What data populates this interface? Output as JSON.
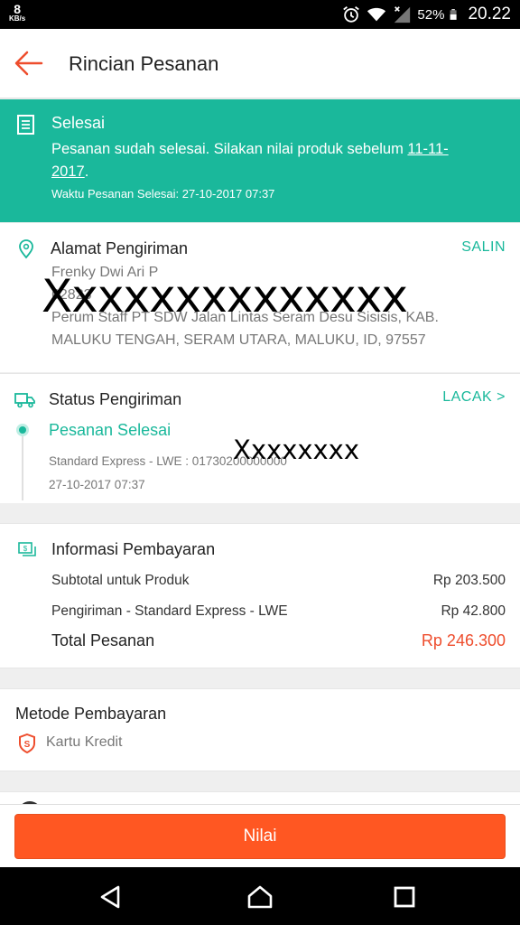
{
  "status_bar": {
    "net_speed_value": "8",
    "net_speed_unit": "KB/s",
    "battery_percent": "52%",
    "time": "20.22",
    "icons": [
      "alarm-icon",
      "wifi-icon",
      "signal-icon",
      "battery-icon"
    ]
  },
  "app_bar": {
    "title": "Rincian Pesanan",
    "accent_color": "#ee4d2d"
  },
  "banner": {
    "title": "Selesai",
    "message_prefix": "Pesanan sudah selesai. Silakan nilai produk sebelum ",
    "message_date": "11-11-2017",
    "message_suffix": ".",
    "completed_time": "Waktu Pesanan Selesai: 27-10-2017 07:37",
    "color": "#1ab89b"
  },
  "address": {
    "title": "Alamat Pengiriman",
    "action": "SALIN",
    "name": "Frenky Dwi Ari P",
    "phone": "62823",
    "line1": "Perum Staff PT SDW Jalan Lintas Seram Desu Sisisis, KAB.",
    "line2": "MALUKU TENGAH, SERAM UTARA, MALUKU, ID, 97557",
    "redaction": "Xxxxxxxxxxxxxx"
  },
  "shipping": {
    "title": "Status Pengiriman",
    "action": "LACAK >",
    "status": "Pesanan Selesai",
    "service": "Standard Express - LWE :  01730200000000",
    "timestamp": "27-10-2017 07:37",
    "redaction": "Xxxxxxxx"
  },
  "payment_info": {
    "title": "Informasi Pembayaran",
    "rows": [
      {
        "label": "Subtotal untuk Produk",
        "value": "Rp 203.500"
      },
      {
        "label": "Pengiriman - Standard Express - LWE",
        "value": "Rp 42.800"
      }
    ],
    "total_label": "Total Pesanan",
    "total_value": "Rp 246.300"
  },
  "payment_method": {
    "title": "Metode Pembayaran",
    "value": "Kartu Kredit"
  },
  "cta": {
    "label": "Nilai",
    "color": "#ff5722"
  },
  "nav": {
    "buttons": [
      "back-nav-icon",
      "home-nav-icon",
      "recents-nav-icon"
    ]
  }
}
